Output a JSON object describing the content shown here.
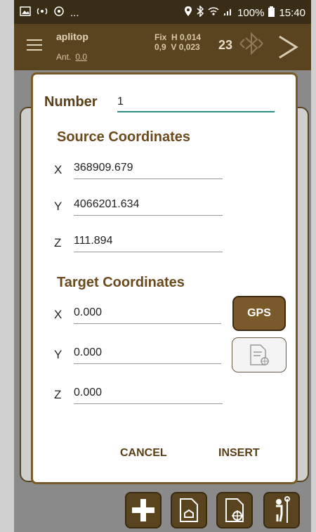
{
  "status_bar": {
    "overflow": "...",
    "battery": "100%",
    "time": "15:40"
  },
  "app_bar": {
    "app_name": "aplitop",
    "ant_label": "Ant.",
    "ant_value": "0.0",
    "fix_label": "Fix",
    "h_value": "H 0,014",
    "pdop": "0,9",
    "v_value": "V 0,023",
    "satellites": "23"
  },
  "dialog": {
    "number_label": "Number",
    "number_value": "1",
    "source_title": "Source Coordinates",
    "source": [
      {
        "axis": "X",
        "value": "368909.679"
      },
      {
        "axis": "Y",
        "value": "4066201.634"
      },
      {
        "axis": "Z",
        "value": "111.894"
      }
    ],
    "target_title": "Target Coordinates",
    "target": [
      {
        "axis": "X",
        "value": "0.000"
      },
      {
        "axis": "Y",
        "value": "0.000"
      },
      {
        "axis": "Z",
        "value": "0.000"
      }
    ],
    "gps_label": "GPS",
    "cancel_label": "CANCEL",
    "insert_label": "INSERT"
  },
  "colors": {
    "accent": "#2b8c80",
    "brand_brown": "#5a4420"
  }
}
